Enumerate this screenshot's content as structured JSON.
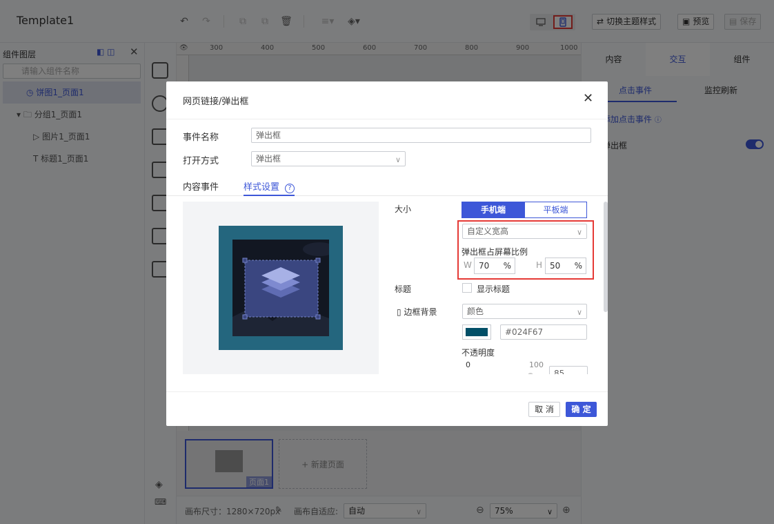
{
  "app": {
    "title": "Template1"
  },
  "toolbar": {
    "undo_icon": "undo-icon",
    "redo_icon": "redo-icon",
    "copy_icon": "copy-icon",
    "paste_icon": "paste-icon",
    "delete_icon": "trash-icon",
    "align_icon": "align-icon",
    "layer_icon": "layers-icon",
    "desktop_icon": "desktop-icon",
    "mobile_icon": "mobile-icon",
    "switch_theme_label": "切换主题样式",
    "preview_label": "预览",
    "save_label": "保存"
  },
  "left_panel": {
    "title": "组件图层",
    "search_placeholder": "请输入组件名称",
    "layers": [
      {
        "label": "饼图1_页面1",
        "icon": "pie-chart-icon",
        "selected": true
      },
      {
        "label": "分组1_页面1",
        "icon": "folder-icon",
        "selected": false
      },
      {
        "label": "图片1_页面1",
        "icon": "image-icon",
        "selected": false
      },
      {
        "label": "标题1_页面1",
        "icon": "text-icon",
        "selected": false
      }
    ]
  },
  "canvas": {
    "ruler_marks": [
      "300",
      "400",
      "500",
      "600",
      "700",
      "800",
      "900",
      "1000"
    ],
    "page_thumb_label": "页面1",
    "new_page_label": "+ 新建页面",
    "size_label": "画布尺寸：1280×720px",
    "adapt_label": "画布自适应:",
    "adapt_value": "自动",
    "zoom_value": "75%"
  },
  "right_panel": {
    "tabs": [
      "内容",
      "交互",
      "组件"
    ],
    "active_tab": "交互",
    "subtabs": [
      "点击事件",
      "监控刷新"
    ],
    "add_event_label": "添加点击事件",
    "event_item_label": "弹出框"
  },
  "modal": {
    "title": "网页链接/弹出框",
    "event_name_label": "事件名称",
    "event_name_value": "弹出框",
    "open_mode_label": "打开方式",
    "open_mode_value": "弹出框",
    "tabs": [
      "内容事件",
      "样式设置"
    ],
    "active_tab": "样式设置",
    "size_label": "大小",
    "device_mobile": "手机端",
    "device_tablet": "平板端",
    "size_mode_value": "自定义宽高",
    "ratio_label": "弹出框占屏幕比例",
    "w_label": "W",
    "w_value": "70",
    "h_label": "H",
    "h_value": "50",
    "percent": "%",
    "title_label": "标题",
    "show_title_label": "显示标题",
    "border_bg_label": "边框背景",
    "border_bg_type": "颜色",
    "color_hex": "#024F67",
    "opacity_label": "不透明度",
    "opacity_min": "0",
    "opacity_max": "100",
    "opacity_value": "85",
    "cancel_label": "取 消",
    "ok_label": "确 定"
  },
  "colors": {
    "accent": "#3d57d8",
    "highlight_red": "#e53935",
    "preview_outer": "#24667e",
    "swatch": "#024F67"
  }
}
